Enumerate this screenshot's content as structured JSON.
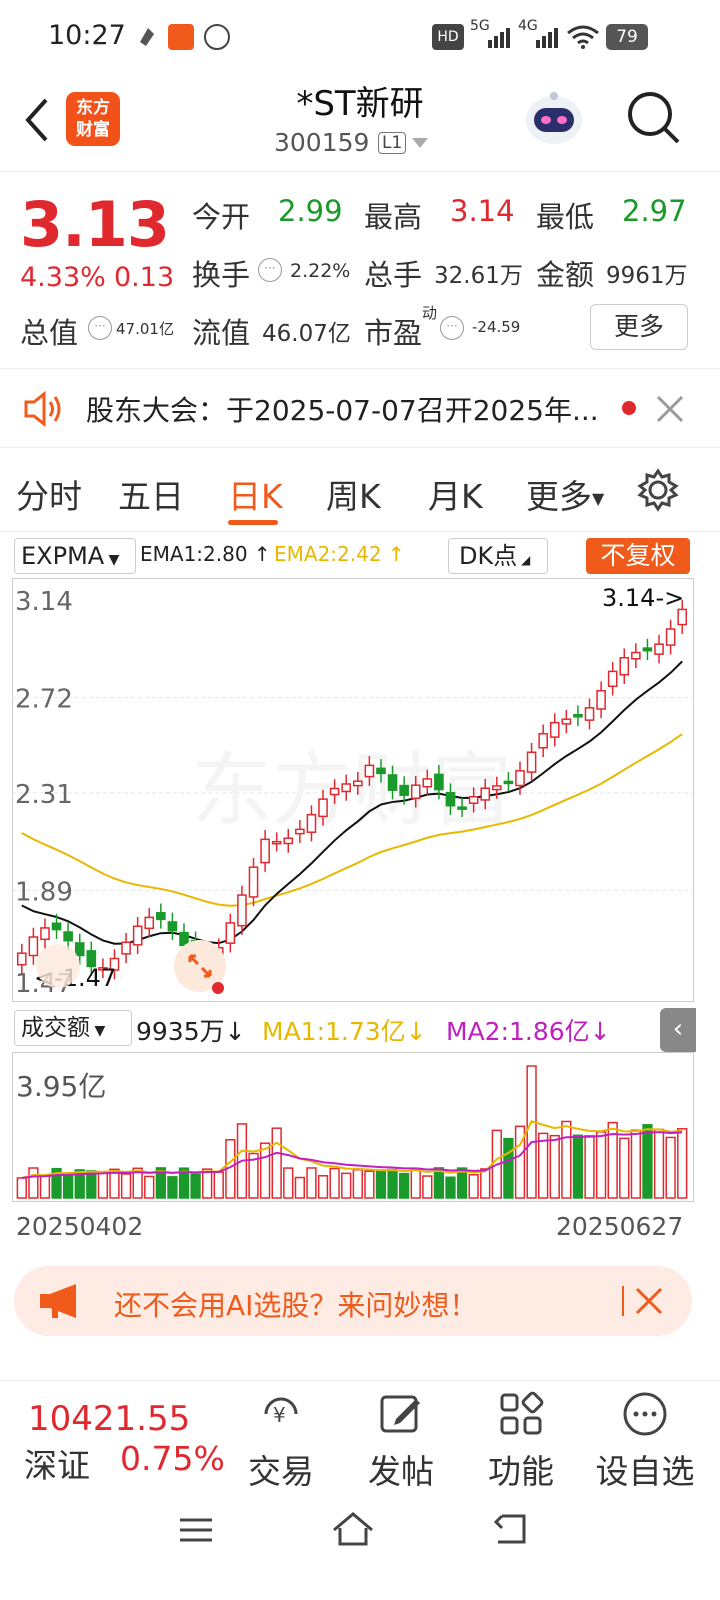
{
  "status_bar": {
    "time": "10:27",
    "battery": "79",
    "net1": "5G",
    "net2": "4G"
  },
  "header": {
    "logo_text": "东方财富",
    "title": "*ST新研",
    "code": "300159",
    "level": "L1"
  },
  "quote": {
    "price": "3.13",
    "change_pct": "4.33%",
    "change_abs": "0.13",
    "open_label": "今开",
    "open": "2.99",
    "high_label": "最高",
    "high": "3.14",
    "low_label": "最低",
    "low": "2.97",
    "turnover_label": "换手",
    "turnover": "2.22%",
    "volume_label": "总手",
    "volume": "32.61万",
    "amount_label": "金额",
    "amount": "9961万",
    "mktcap_label": "总值",
    "mktcap": "47.01亿",
    "float_label": "流值",
    "float": "46.07亿",
    "pe_label": "市盈",
    "pe_sup": "动",
    "pe": "-24.59",
    "more": "更多"
  },
  "notice": {
    "text": "股东大会：于2025-07-07召开2025年..."
  },
  "tabs": [
    "分时",
    "五日",
    "日K",
    "周K",
    "月K",
    "更多"
  ],
  "indicator": {
    "name": "EXPMA",
    "ema1": "EMA1:2.80",
    "ema2": "EMA2:2.42",
    "dk": "DK点",
    "adjust": "不复权"
  },
  "chart_data": {
    "type": "candlestick",
    "y_ticks": [
      "3.14",
      "2.72",
      "2.31",
      "1.89",
      "1.47"
    ],
    "ylim": [
      1.47,
      3.14
    ],
    "max_label": "3.14->",
    "min_label": "<-1.47",
    "x_start": "20250402",
    "x_end": "20250627",
    "colors": {
      "up": "#e0292f",
      "down": "#1a9a2a",
      "ema1": "#111111",
      "ema2": "#e8b800",
      "ma1": "#e8b800",
      "ma2": "#c020c0"
    }
  },
  "volume": {
    "name": "成交额",
    "value": "9935万",
    "ma1": "MA1:1.73亿",
    "ma2": "MA2:1.86亿",
    "max_label": "3.95亿"
  },
  "ai_banner": {
    "text": "还不会用AI选股？来问妙想！"
  },
  "bottom_bar": {
    "index_value": "10421.55",
    "index_name": "深证",
    "index_change": "0.75%",
    "items": [
      "交易",
      "发帖",
      "功能",
      "设自选"
    ]
  }
}
